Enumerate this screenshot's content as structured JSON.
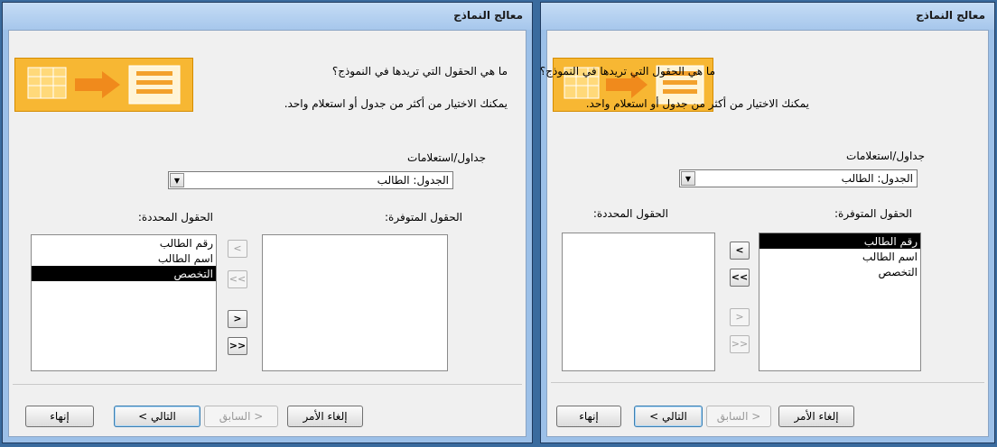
{
  "dialogs": [
    {
      "title": "معالج النماذج",
      "question": "ما هي الحقول التي تريدها في النموذج؟",
      "hint": "يمكنك الاختيار من أكثر من جدول أو استعلام واحد.",
      "tables_label": "جداول/استعلامات",
      "table_value": "الجدول: الطالب",
      "available_label": "الحقول المتوفرة:",
      "selected_label": "الحقول المحددة:",
      "available_fields": [],
      "selected_fields": [
        "رقم الطالب",
        "اسم الطالب",
        "التخصص"
      ],
      "selected_highlight": "التخصص",
      "move_one": ">",
      "move_all": ">>",
      "remove_one": "<",
      "remove_all": "<<",
      "cancel": "إلغاء الأمر",
      "back": "< السابق",
      "next": "التالي >",
      "finish": "إنهاء"
    },
    {
      "title": "معالج النماذج",
      "question": "ما هي الحقول التي تريدها في النموذج؟",
      "hint": "يمكنك الاختيار من أكثر من جدول أو استعلام واحد.",
      "tables_label": "جداول/استعلامات",
      "table_value": "الجدول: الطالب",
      "available_label": "الحقول المتوفرة:",
      "selected_label": "الحقول المحددة:",
      "available_fields": [
        "رقم الطالب",
        "اسم الطالب",
        "التخصص"
      ],
      "available_highlight": "رقم الطالب",
      "selected_fields": [],
      "move_one": ">",
      "move_all": ">>",
      "remove_one": "<",
      "remove_all": "<<",
      "cancel": "إلغاء الأمر",
      "back": "< السابق",
      "next": "التالي >",
      "finish": "إنهاء"
    }
  ],
  "colors": {
    "banner": "#f7b733",
    "selection": "#000000",
    "window_frame": "#9cc0e8"
  },
  "icons": [
    "wizard-banner-icon",
    "dropdown-arrow-icon"
  ]
}
